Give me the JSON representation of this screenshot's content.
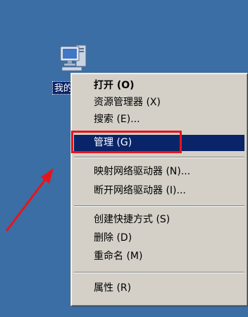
{
  "desktop": {
    "icon_label": "我的"
  },
  "context_menu": {
    "items": [
      {
        "label": "打开 (O)"
      },
      {
        "label": "资源管理器 (X)"
      },
      {
        "label": "搜索 (E)..."
      },
      {
        "label": "管理 (G)"
      },
      {
        "label": "映射网络驱动器 (N)..."
      },
      {
        "label": "断开网络驱动器 (I)..."
      },
      {
        "label": "创建快捷方式 (S)"
      },
      {
        "label": "删除 (D)"
      },
      {
        "label": "重命名 (M)"
      },
      {
        "label": "属性 (R)"
      }
    ],
    "selected_index": 3
  },
  "colors": {
    "desktop_background": "#3a6ea5",
    "menu_background": "#d4d0c8",
    "selection": "#0a246a",
    "annotation_red": "#e8141c"
  }
}
